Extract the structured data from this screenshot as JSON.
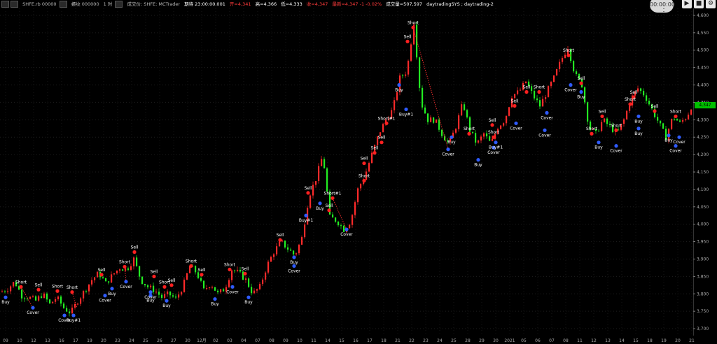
{
  "header": {
    "symbol": "SHFE.rb 00000",
    "name": "螺纹 000000",
    "interval": "1 时",
    "data_source": "成交价: SHFE: MCTrader",
    "time": "期待 23:00:00.001",
    "open": "开=4,341",
    "high": "高=4,366",
    "low": "低=4,333",
    "close": "收=4,347",
    "last": "最新=4,347 -1 -0.02%",
    "volume": "成交量=507,597",
    "strategy": "daytradingSYS ; daytrading-2"
  },
  "clock": "00:00:00",
  "last_price": "4,347",
  "colors": {
    "up": "#ff2a2a",
    "down": "#22ee22",
    "buy_marker": "#2f5bff",
    "sell_marker": "#ff2020",
    "trade_line": "#ff3030"
  },
  "chart_data": {
    "type": "candlestick",
    "ylim": [
      3680,
      4620
    ],
    "yticks": [
      "4,600",
      "4,550",
      "4,500",
      "4,450",
      "4,400",
      "4,350",
      "4,300",
      "4,250",
      "4,200",
      "4,150",
      "4,100",
      "4,050",
      "4,000",
      "3,950",
      "3,900",
      "3,850",
      "3,800",
      "3,750",
      "3,700"
    ],
    "xticks": [
      "09",
      "10",
      "12",
      "13",
      "16",
      "17",
      "19",
      "20",
      "23",
      "24",
      "25",
      "26",
      "27",
      "30",
      "12月",
      "02",
      "03",
      "04",
      "07",
      "08",
      "09",
      "10",
      "11",
      "14",
      "15",
      "16",
      "17",
      "18",
      "21",
      "22",
      "23",
      "24",
      "25",
      "28",
      "29",
      "30",
      "2021",
      "05",
      "06",
      "07",
      "08",
      "11",
      "12",
      "13",
      "14",
      "15",
      "18",
      "19",
      "20",
      "21"
    ],
    "price_path": [
      [
        0,
        3805
      ],
      [
        10,
        3815
      ],
      [
        20,
        3835
      ],
      [
        30,
        3795
      ],
      [
        40,
        3790
      ],
      [
        50,
        3780
      ],
      [
        60,
        3800
      ],
      [
        70,
        3770
      ],
      [
        80,
        3790
      ],
      [
        90,
        3760
      ],
      [
        100,
        3745
      ],
      [
        110,
        3780
      ],
      [
        120,
        3810
      ],
      [
        130,
        3840
      ],
      [
        140,
        3860
      ],
      [
        150,
        3830
      ],
      [
        160,
        3855
      ],
      [
        170,
        3875
      ],
      [
        180,
        3870
      ],
      [
        190,
        3900
      ],
      [
        200,
        3840
      ],
      [
        210,
        3820
      ],
      [
        220,
        3810
      ],
      [
        230,
        3790
      ],
      [
        240,
        3800
      ],
      [
        250,
        3785
      ],
      [
        260,
        3820
      ],
      [
        270,
        3880
      ],
      [
        280,
        3860
      ],
      [
        290,
        3810
      ],
      [
        300,
        3830
      ],
      [
        310,
        3800
      ],
      [
        320,
        3815
      ],
      [
        330,
        3870
      ],
      [
        340,
        3860
      ],
      [
        350,
        3840
      ],
      [
        360,
        3800
      ],
      [
        370,
        3820
      ],
      [
        380,
        3880
      ],
      [
        390,
        3920
      ],
      [
        400,
        3950
      ],
      [
        410,
        3930
      ],
      [
        420,
        3910
      ],
      [
        430,
        3960
      ],
      [
        440,
        4080
      ],
      [
        450,
        4130
      ],
      [
        460,
        4200
      ],
      [
        470,
        4020
      ],
      [
        480,
        4010
      ],
      [
        490,
        3985
      ],
      [
        500,
        4010
      ],
      [
        510,
        4100
      ],
      [
        520,
        4140
      ],
      [
        530,
        4200
      ],
      [
        540,
        4260
      ],
      [
        550,
        4300
      ],
      [
        560,
        4330
      ],
      [
        570,
        4420
      ],
      [
        580,
        4440
      ],
      [
        590,
        4580
      ],
      [
        600,
        4350
      ],
      [
        610,
        4300
      ],
      [
        620,
        4300
      ],
      [
        630,
        4260
      ],
      [
        640,
        4230
      ],
      [
        650,
        4280
      ],
      [
        660,
        4350
      ],
      [
        670,
        4270
      ],
      [
        680,
        4230
      ],
      [
        690,
        4260
      ],
      [
        700,
        4230
      ],
      [
        710,
        4280
      ],
      [
        720,
        4300
      ],
      [
        730,
        4370
      ],
      [
        740,
        4380
      ],
      [
        750,
        4410
      ],
      [
        760,
        4370
      ],
      [
        770,
        4340
      ],
      [
        780,
        4380
      ],
      [
        790,
        4420
      ],
      [
        800,
        4470
      ],
      [
        810,
        4510
      ],
      [
        820,
        4430
      ],
      [
        830,
        4400
      ],
      [
        840,
        4280
      ],
      [
        850,
        4260
      ],
      [
        860,
        4300
      ],
      [
        870,
        4280
      ],
      [
        880,
        4260
      ],
      [
        890,
        4300
      ],
      [
        900,
        4360
      ],
      [
        910,
        4390
      ],
      [
        920,
        4370
      ],
      [
        930,
        4330
      ],
      [
        940,
        4290
      ],
      [
        950,
        4250
      ],
      [
        960,
        4310
      ],
      [
        970,
        4290
      ],
      [
        980,
        4310
      ],
      [
        988,
        4347
      ]
    ],
    "signals": [
      {
        "label": "Buy",
        "x": 8,
        "price": 3790,
        "side": "buy"
      },
      {
        "label": "Short",
        "x": 30,
        "price": 3820,
        "side": "sell"
      },
      {
        "label": "Sell",
        "x": 55,
        "price": 3812,
        "side": "sell"
      },
      {
        "label": "Cover",
        "x": 47,
        "price": 3760,
        "side": "buy"
      },
      {
        "label": "Short",
        "x": 82,
        "price": 3808,
        "side": "sell"
      },
      {
        "label": "Cover",
        "x": 92,
        "price": 3738,
        "side": "buy"
      },
      {
        "label": "Buy#1",
        "x": 105,
        "price": 3738,
        "side": "buy"
      },
      {
        "label": "Short",
        "x": 103,
        "price": 3805,
        "side": "sell"
      },
      {
        "label": "Sell",
        "x": 145,
        "price": 3855,
        "side": "sell"
      },
      {
        "label": "Buy",
        "x": 160,
        "price": 3815,
        "side": "buy"
      },
      {
        "label": "Cover",
        "x": 150,
        "price": 3795,
        "side": "buy"
      },
      {
        "label": "Short",
        "x": 178,
        "price": 3878,
        "side": "sell"
      },
      {
        "label": "Sell",
        "x": 192,
        "price": 3920,
        "side": "sell"
      },
      {
        "label": "Cover",
        "x": 180,
        "price": 3835,
        "side": "buy"
      },
      {
        "label": "Buy",
        "x": 215,
        "price": 3795,
        "side": "buy"
      },
      {
        "label": "Cover",
        "x": 215,
        "price": 3805,
        "side": "buy"
      },
      {
        "label": "Sell",
        "x": 220,
        "price": 3850,
        "side": "sell"
      },
      {
        "label": "Short",
        "x": 235,
        "price": 3820,
        "side": "sell"
      },
      {
        "label": "Buy",
        "x": 238,
        "price": 3780,
        "side": "buy"
      },
      {
        "label": "Sell",
        "x": 245,
        "price": 3825,
        "side": "sell"
      },
      {
        "label": "Short",
        "x": 273,
        "price": 3880,
        "side": "sell"
      },
      {
        "label": "Sell",
        "x": 288,
        "price": 3855,
        "side": "sell"
      },
      {
        "label": "Buy",
        "x": 307,
        "price": 3785,
        "side": "buy"
      },
      {
        "label": "Short",
        "x": 328,
        "price": 3870,
        "side": "sell"
      },
      {
        "label": "Sell",
        "x": 350,
        "price": 3858,
        "side": "sell"
      },
      {
        "label": "Cover",
        "x": 332,
        "price": 3820,
        "side": "buy"
      },
      {
        "label": "Buy",
        "x": 355,
        "price": 3790,
        "side": "buy"
      },
      {
        "label": "Sell",
        "x": 400,
        "price": 3955,
        "side": "sell"
      },
      {
        "label": "Buy",
        "x": 420,
        "price": 3905,
        "side": "buy"
      },
      {
        "label": "Cover",
        "x": 420,
        "price": 3880,
        "side": "buy"
      },
      {
        "label": "Sell",
        "x": 440,
        "price": 4090,
        "side": "sell"
      },
      {
        "label": "Buy",
        "x": 457,
        "price": 4060,
        "side": "buy"
      },
      {
        "label": "Buy#1",
        "x": 437,
        "price": 4025,
        "side": "buy"
      },
      {
        "label": "Short#1",
        "x": 475,
        "price": 4075,
        "side": "sell"
      },
      {
        "label": "Sell",
        "x": 470,
        "price": 4040,
        "side": "sell"
      },
      {
        "label": "Cover",
        "x": 495,
        "price": 3985,
        "side": "buy"
      },
      {
        "label": "Short",
        "x": 520,
        "price": 4125,
        "side": "sell"
      },
      {
        "label": "Sell",
        "x": 520,
        "price": 4175,
        "side": "sell"
      },
      {
        "label": "Sell",
        "x": 535,
        "price": 4205,
        "side": "sell"
      },
      {
        "label": "Short#1",
        "x": 552,
        "price": 4290,
        "side": "sell"
      },
      {
        "label": "Sell",
        "x": 545,
        "price": 4235,
        "side": "sell"
      },
      {
        "label": "Buy",
        "x": 570,
        "price": 4400,
        "side": "buy"
      },
      {
        "label": "Buy#1",
        "x": 580,
        "price": 4330,
        "side": "buy"
      },
      {
        "label": "Sell",
        "x": 582,
        "price": 4525,
        "side": "sell"
      },
      {
        "label": "Short",
        "x": 590,
        "price": 4565,
        "side": "sell"
      },
      {
        "label": "Cover",
        "x": 640,
        "price": 4215,
        "side": "buy"
      },
      {
        "label": "Buy",
        "x": 645,
        "price": 4250,
        "side": "buy"
      },
      {
        "label": "Short",
        "x": 670,
        "price": 4260,
        "side": "sell"
      },
      {
        "label": "Buy",
        "x": 683,
        "price": 4185,
        "side": "buy"
      },
      {
        "label": "Cover",
        "x": 705,
        "price": 4220,
        "side": "buy"
      },
      {
        "label": "Short",
        "x": 705,
        "price": 4250,
        "side": "sell"
      },
      {
        "label": "Buy#1",
        "x": 708,
        "price": 4235,
        "side": "buy"
      },
      {
        "label": "Sell",
        "x": 703,
        "price": 4285,
        "side": "sell"
      },
      {
        "label": "Sell",
        "x": 735,
        "price": 4340,
        "side": "sell"
      },
      {
        "label": "Sell",
        "x": 752,
        "price": 4380,
        "side": "sell"
      },
      {
        "label": "Cover",
        "x": 737,
        "price": 4290,
        "side": "buy"
      },
      {
        "label": "Short",
        "x": 770,
        "price": 4380,
        "side": "sell"
      },
      {
        "label": "Cover",
        "x": 778,
        "price": 4270,
        "side": "buy"
      },
      {
        "label": "Cover",
        "x": 781,
        "price": 4320,
        "side": "buy"
      },
      {
        "label": "Short",
        "x": 812,
        "price": 4485,
        "side": "sell"
      },
      {
        "label": "Sell",
        "x": 830,
        "price": 4405,
        "side": "sell"
      },
      {
        "label": "Buy",
        "x": 830,
        "price": 4380,
        "side": "buy"
      },
      {
        "label": "Cover",
        "x": 815,
        "price": 4400,
        "side": "buy"
      },
      {
        "label": "Short",
        "x": 845,
        "price": 4260,
        "side": "sell"
      },
      {
        "label": "Sell",
        "x": 860,
        "price": 4310,
        "side": "sell"
      },
      {
        "label": "Buy",
        "x": 855,
        "price": 4235,
        "side": "buy"
      },
      {
        "label": "Short",
        "x": 880,
        "price": 4270,
        "side": "sell"
      },
      {
        "label": "Cover",
        "x": 880,
        "price": 4225,
        "side": "buy"
      },
      {
        "label": "Buy",
        "x": 912,
        "price": 4310,
        "side": "buy"
      },
      {
        "label": "Sell",
        "x": 905,
        "price": 4365,
        "side": "sell"
      },
      {
        "label": "Short",
        "x": 900,
        "price": 4345,
        "side": "sell"
      },
      {
        "label": "Buy",
        "x": 912,
        "price": 4275,
        "side": "buy"
      },
      {
        "label": "Sell",
        "x": 935,
        "price": 4325,
        "side": "sell"
      },
      {
        "label": "Buy",
        "x": 955,
        "price": 4255,
        "side": "buy"
      },
      {
        "label": "Short",
        "x": 965,
        "price": 4310,
        "side": "sell"
      },
      {
        "label": "Cover",
        "x": 965,
        "price": 4225,
        "side": "buy"
      },
      {
        "label": "Cover",
        "x": 970,
        "price": 4250,
        "side": "buy"
      }
    ],
    "trade_lines": [
      [
        [
          30,
          3820
        ],
        [
          47,
          3760
        ]
      ],
      [
        [
          103,
          3805
        ],
        [
          110,
          3760
        ]
      ],
      [
        [
          590,
          4565
        ],
        [
          640,
          4215
        ]
      ],
      [
        [
          475,
          4075
        ],
        [
          495,
          3985
        ]
      ],
      [
        [
          178,
          3878
        ],
        [
          180,
          3835
        ]
      ]
    ]
  }
}
